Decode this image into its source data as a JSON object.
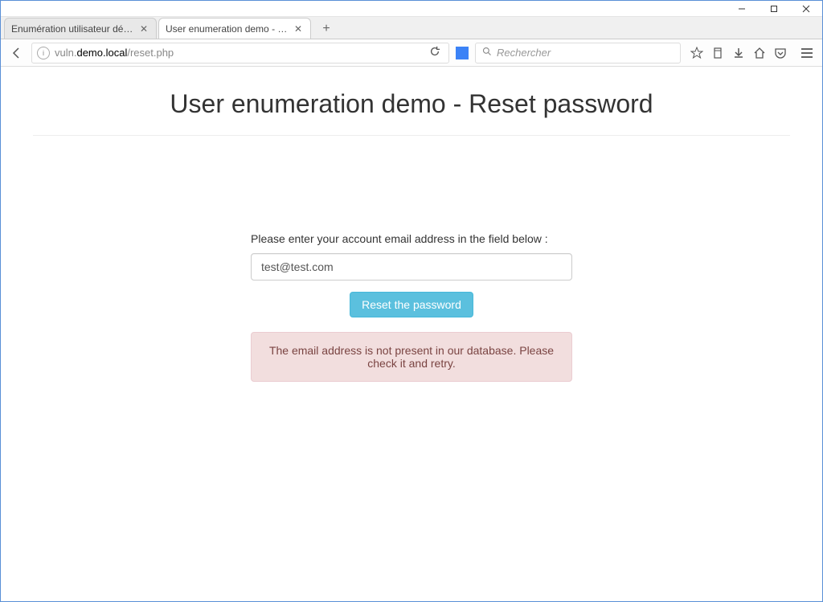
{
  "window": {
    "controls": {
      "min": "–",
      "max": "☐",
      "close": "✕"
    }
  },
  "tabs": [
    {
      "label": "Enumération utilisateur démo - I"
    },
    {
      "label": "User enumeration demo - Reset"
    }
  ],
  "url": {
    "prefix": "vuln.",
    "domain": "demo.local",
    "path": "/reset.php"
  },
  "search": {
    "placeholder": "Rechercher"
  },
  "page": {
    "title": "User enumeration demo - Reset password",
    "form_label": "Please enter your account email address in the field below :",
    "email_value": "test@test.com",
    "button_label": "Reset the password",
    "alert_message": "The email address is not present in our database. Please check it and retry."
  }
}
